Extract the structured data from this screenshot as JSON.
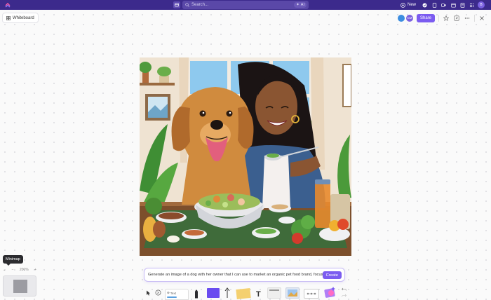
{
  "topbar": {
    "search_placeholder": "Search...",
    "ai_label": "AI",
    "new_label": "New",
    "user_initial": "B"
  },
  "whiteboard": {
    "tab_label": "Whiteboard"
  },
  "header": {
    "share_label": "Share",
    "collab_avatars": [
      {
        "initial": "",
        "color": "#3c8de0"
      },
      {
        "initial": "CM",
        "color": "#7b61e0"
      }
    ]
  },
  "canvas_image": {
    "description_alt": ""
  },
  "ai_prompt": {
    "text": "Generate an image of a dog with her owner that I can use to market an organic pet food brand, focusing on",
    "create_label": "Create"
  },
  "toolbar": {
    "tools": [
      "select",
      "hand",
      "pen",
      "shape",
      "connector",
      "sticky",
      "text",
      "card",
      "media",
      "template",
      "ai"
    ],
    "text_tool_label": "Text",
    "colors": {
      "shape": "#6a4cf0",
      "sticky": "#f4d06f",
      "accent": "#7b5cf0"
    }
  },
  "minimap": {
    "tooltip": "Minimap",
    "zoom": "200%"
  }
}
